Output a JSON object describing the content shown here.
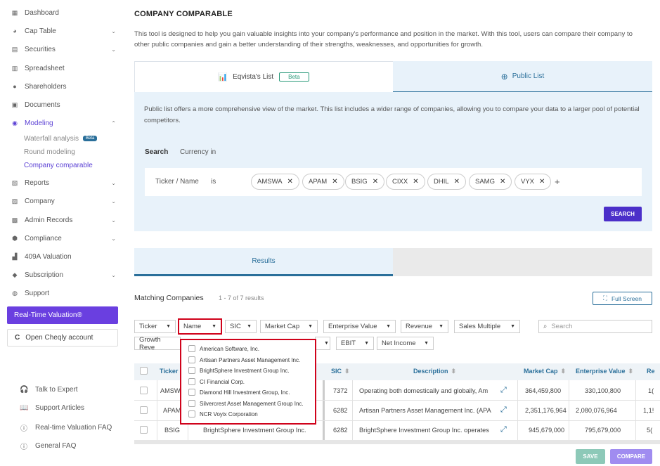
{
  "sidebar": {
    "items": [
      {
        "label": "Dashboard",
        "icon": "dashboard-icon"
      },
      {
        "label": "Cap Table",
        "icon": "cap-table-icon"
      },
      {
        "label": "Securities",
        "icon": "securities-icon"
      },
      {
        "label": "Spreadsheet",
        "icon": "spreadsheet-icon"
      },
      {
        "label": "Shareholders",
        "icon": "shareholders-icon"
      },
      {
        "label": "Documents",
        "icon": "documents-icon"
      },
      {
        "label": "Modeling",
        "icon": "modeling-icon"
      },
      {
        "label": "Reports",
        "icon": "reports-icon"
      },
      {
        "label": "Company",
        "icon": "company-icon"
      },
      {
        "label": "Admin Records",
        "icon": "admin-records-icon"
      },
      {
        "label": "Compliance",
        "icon": "compliance-icon"
      },
      {
        "label": "409A Valuation",
        "icon": "valuation-icon"
      },
      {
        "label": "Subscription",
        "icon": "subscription-icon"
      },
      {
        "label": "Support",
        "icon": "support-icon"
      }
    ],
    "modeling_sub": [
      {
        "label": "Waterfall analysis",
        "badge": "Beta"
      },
      {
        "label": "Round modeling"
      },
      {
        "label": "Company comparable"
      }
    ],
    "rtv_label": "Real-Time Valuation®",
    "cheqly_label": "Open Cheqly account",
    "footer": [
      {
        "label": "Talk to Expert",
        "icon": "headset-icon"
      },
      {
        "label": "Support Articles",
        "icon": "book-icon"
      },
      {
        "label": "Real-time Valuation FAQ",
        "icon": "help-circle-icon"
      },
      {
        "label": "General FAQ",
        "icon": "help-circle-icon"
      }
    ]
  },
  "main": {
    "title": "COMPANY COMPARABLE",
    "intro": "This tool is designed to help you gain valuable insights into your company's performance and position in the market. With this tool, users can compare their company to other public companies and gain a better understanding of their strengths, weaknesses, and opportunities for growth.",
    "tabs": [
      {
        "label": "Eqvista's List",
        "badge": "Beta"
      },
      {
        "label": "Public List"
      }
    ],
    "public_desc": "Public list offers a more comprehensive view of the market. This list includes a wider range of companies, allowing you to compare your data to a larger pool of potential competitors.",
    "search_label": "Search",
    "currency_label": "Currency in",
    "criteria_field": "Ticker / Name",
    "criteria_op": "is",
    "chips": [
      "AMSWA",
      "APAM",
      "BSIG",
      "CIXX",
      "DHIL",
      "SAMG",
      "VYX"
    ],
    "search_button": "SEARCH",
    "results_tab": "Results",
    "matching_label": "Matching Companies",
    "results_count": "1 - 7 of 7 results",
    "fullscreen_button": "Full Screen",
    "filters_row1": [
      "Ticker",
      "Name",
      "SIC",
      "Market Cap",
      "Enterprise Value",
      "Revenue",
      "Sales Multiple"
    ],
    "filters_row2": [
      "Growth Reve",
      "EBIT",
      "Net Income"
    ],
    "table_search_placeholder": "Search",
    "columns": [
      "Ticker",
      "SIC",
      "Description",
      "Market Cap",
      "Enterprise Value",
      "Re"
    ],
    "rows": [
      {
        "ticker": "AMSW",
        "name": "",
        "sic": "7372",
        "desc": "Operating both domestically and globally, Am",
        "mcap": "364,459,800",
        "ev": "330,100,800",
        "rev": "1("
      },
      {
        "ticker": "APAM",
        "name": "",
        "sic": "6282",
        "desc": "Artisan Partners Asset Management Inc. (APA",
        "mcap": "2,351,176,964",
        "ev": "2,080,076,964",
        "rev": "1,1!"
      },
      {
        "ticker": "BSIG",
        "name": "BrightSphere Investment Group Inc.",
        "sic": "6282",
        "desc": "BrightSphere Investment Group Inc. operates",
        "mcap": "945,679,000",
        "ev": "795,679,000",
        "rev": "5("
      }
    ],
    "dropdown_options": [
      "American Software, Inc.",
      "Artisan Partners Asset Management Inc.",
      "BrightSphere Investment Group Inc.",
      "CI Financial Corp.",
      "Diamond Hill Investment Group, Inc.",
      "Silvercrest Asset Management Group Inc.",
      "NCR Voyix Corporation"
    ],
    "save_button": "SAVE",
    "compare_button": "COMPARE"
  },
  "colors": {
    "accent": "#5a3fd4",
    "primary_blue": "#2a6f9a",
    "highlight_red": "#d0021b"
  }
}
